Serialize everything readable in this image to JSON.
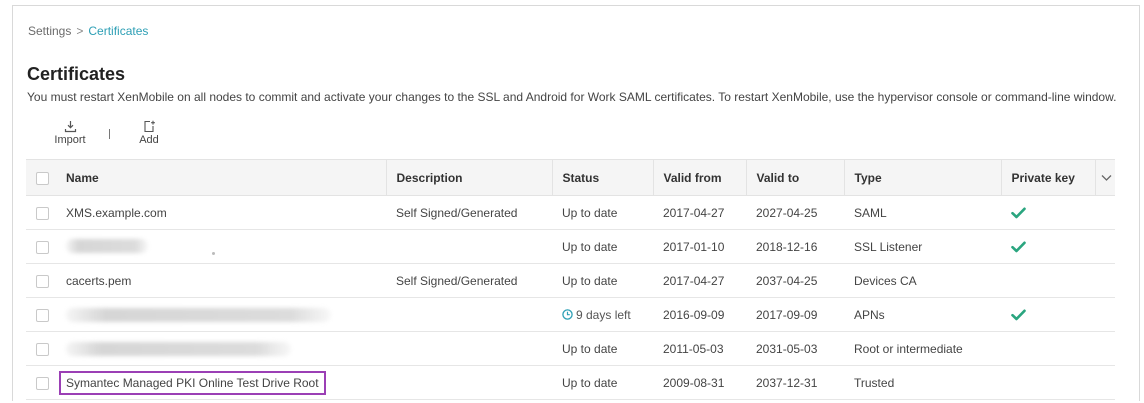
{
  "breadcrumb": {
    "parent": "Settings",
    "separator": ">",
    "current": "Certificates"
  },
  "page": {
    "title": "Certificates",
    "notice": "You must restart XenMobile on all nodes to commit and activate your changes to the SSL and Android for Work SAML certificates. To restart XenMobile, use the hypervisor console or command-line window."
  },
  "toolbar": {
    "import_label": "Import",
    "add_label": "Add"
  },
  "table": {
    "columns": [
      "Name",
      "Description",
      "Status",
      "Valid from",
      "Valid to",
      "Type",
      "Private key"
    ],
    "rows": [
      {
        "name": "XMS.example.com",
        "description": "Self Signed/Generated",
        "status": "Up to date",
        "valid_from": "2017-04-27",
        "valid_to": "2027-04-25",
        "type": "SAML",
        "private_key": true
      },
      {
        "name": "",
        "description": "",
        "status": "Up to date",
        "valid_from": "2017-01-10",
        "valid_to": "2018-12-16",
        "type": "SSL Listener",
        "private_key": true
      },
      {
        "name": "cacerts.pem",
        "description": "Self Signed/Generated",
        "status": "Up to date",
        "valid_from": "2017-04-27",
        "valid_to": "2037-04-25",
        "type": "Devices CA",
        "private_key": false
      },
      {
        "name": "",
        "description": "",
        "status": "9 days left",
        "valid_from": "2016-09-09",
        "valid_to": "2017-09-09",
        "type": "APNs",
        "private_key": true
      },
      {
        "name": "",
        "description": "",
        "status": "Up to date",
        "valid_from": "2011-05-03",
        "valid_to": "2031-05-03",
        "type": "Root or intermediate",
        "private_key": false
      },
      {
        "name": "Symantec Managed PKI Online Test Drive Root",
        "description": "",
        "status": "Up to date",
        "valid_from": "2009-08-31",
        "valid_to": "2037-12-31",
        "type": "Trusted",
        "private_key": false
      }
    ]
  },
  "colors": {
    "accent": "#2d9fb5",
    "check": "#2aa57f",
    "highlight": "#9b3fb5"
  },
  "icons": {
    "import": "download-tray-icon",
    "add": "add-document-icon",
    "check": "check-icon",
    "clock": "clock-icon",
    "column_menu": "chevron-down-icon"
  }
}
